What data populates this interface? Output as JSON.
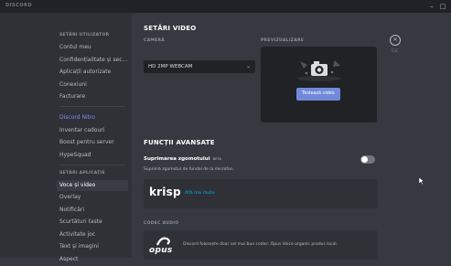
{
  "app": {
    "brand": "DISCORD",
    "window_controls": [
      "–",
      "□"
    ]
  },
  "sidebar": {
    "user_settings_category": "SETĂRI UTILIZATOR",
    "user_items": [
      {
        "label": "Contul meu"
      },
      {
        "label": "Confidențialitate și sec..."
      },
      {
        "label": "Aplicații autorizate"
      },
      {
        "label": "Conexiuni"
      },
      {
        "label": "Facturare"
      }
    ],
    "nitro_items": [
      {
        "label": "Discord Nitro"
      },
      {
        "label": "Inventar cadouri"
      },
      {
        "label": "Boost pentru server"
      },
      {
        "label": "HypeSquad"
      }
    ],
    "app_settings_category": "SETĂRI APLICAȚIE",
    "app_items": [
      {
        "label": "Voce și video"
      },
      {
        "label": "Overlay"
      },
      {
        "label": "Notificări"
      },
      {
        "label": "Scurtături taste"
      },
      {
        "label": "Activitate joc"
      },
      {
        "label": "Text și imagini"
      },
      {
        "label": "Aspect"
      }
    ]
  },
  "main": {
    "video_title": "SETĂRI VIDEO",
    "camera_label": "CAMERĂ",
    "camera_value": "HD 2MP WEBCAM",
    "preview_label": "PREVIZUALIZARE",
    "test_button": "Testează video",
    "close_label": "ESC",
    "advanced_title": "FUNCȚII AVANSATE",
    "noise_title": "Suprimarea zgomotului",
    "noise_beta": "BETA",
    "noise_desc": "Suprimă zgomotul de fundal de la microfon.",
    "noise_enabled": false,
    "krisp_logo": "krisp",
    "krisp_link": "Află mai multe",
    "codec_label": "CODEC AUDIO",
    "opus_logo": "opus",
    "opus_desc": "Discord folosește doar cel mai bun codec: Opus Voice organic produs local."
  },
  "colors": {
    "accent": "#7289da",
    "link": "#00b0f4",
    "background": "#36393f",
    "sidebar": "#2f3136",
    "input": "#202225"
  },
  "icons": [
    "close-icon",
    "chevron-down-icon",
    "camera-icon",
    "opus-logo-icon",
    "mouse-cursor-icon"
  ]
}
